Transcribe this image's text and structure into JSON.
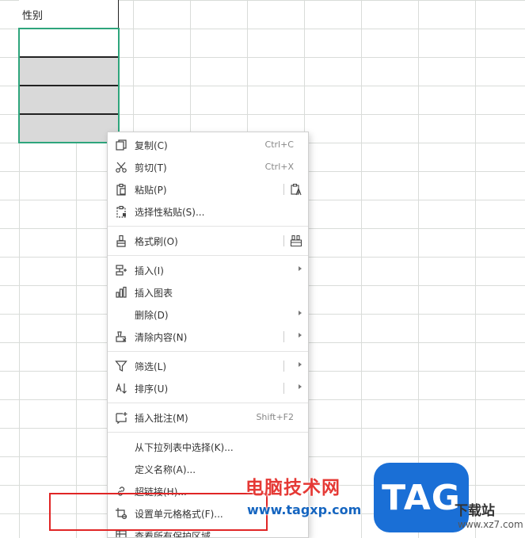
{
  "sheet": {
    "header_cell": "性别"
  },
  "context_menu": {
    "items": [
      {
        "label": "复制(C)",
        "shortcut": "Ctrl+C"
      },
      {
        "label": "剪切(T)",
        "shortcut": "Ctrl+X"
      },
      {
        "label": "粘贴(P)"
      },
      {
        "label": "选择性粘贴(S)..."
      },
      {
        "label": "格式刷(O)"
      },
      {
        "label": "插入(I)"
      },
      {
        "label": "插入图表"
      },
      {
        "label": "删除(D)"
      },
      {
        "label": "清除内容(N)"
      },
      {
        "label": "筛选(L)"
      },
      {
        "label": "排序(U)"
      },
      {
        "label": "插入批注(M)",
        "shortcut": "Shift+F2"
      },
      {
        "label": "从下拉列表中选择(K)..."
      },
      {
        "label": "定义名称(A)..."
      },
      {
        "label": "超链接(H)..."
      },
      {
        "label": "设置单元格格式(F)..."
      },
      {
        "label": "查看所有保护区域"
      }
    ]
  },
  "watermark": {
    "title": "电脑技术网",
    "url": "www.tagxp.com",
    "logo": "TAG",
    "brand": "下载站",
    "brand_url": "www.xz7.com"
  },
  "colors": {
    "selection": "#2ea57c",
    "annotation": "#e02525",
    "watermark_red": "#e53935",
    "watermark_blue": "#1565c0",
    "logo_blue": "#1a6fd6"
  }
}
